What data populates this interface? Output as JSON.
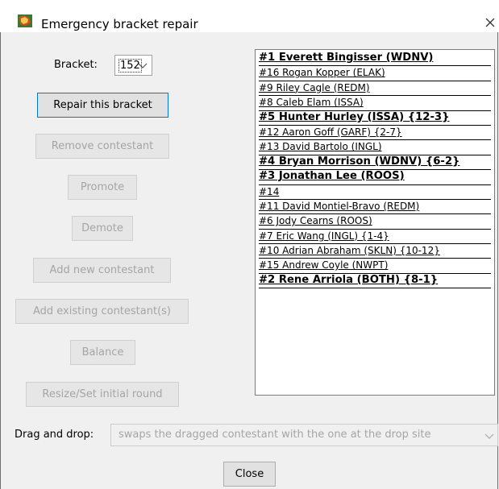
{
  "window": {
    "title": "Emergency bracket repair",
    "icon": "trophy-app-icon"
  },
  "bracket": {
    "label": "Bracket:",
    "value": "152"
  },
  "buttons": {
    "repair": "Repair this bracket",
    "remove": "Remove contestant",
    "promote": "Promote",
    "demote": "Demote",
    "add_new": "Add new contestant",
    "add_existing": "Add existing contestant(s)",
    "balance": "Balance",
    "resize": "Resize/Set initial round",
    "close": "Close"
  },
  "contestants": [
    {
      "text": "#1 Everett Bingisser (WDNV)",
      "bold": true
    },
    {
      "text": "#16 Rogan Kopper (ELAK)",
      "bold": false
    },
    {
      "text": "#9 Riley Cagle (REDM)",
      "bold": false
    },
    {
      "text": "#8 Caleb Elam (ISSA)",
      "bold": false
    },
    {
      "text": "#5 Hunter Hurley (ISSA) {12-3}",
      "bold": true
    },
    {
      "text": "#12 Aaron Goff (GARF) {2-7}",
      "bold": false
    },
    {
      "text": "#13 David Bartolo (INGL)",
      "bold": false
    },
    {
      "text": "#4 Bryan Morrison (WDNV) {6-2}",
      "bold": true
    },
    {
      "text": "#3 Jonathan Lee (ROOS)",
      "bold": true
    },
    {
      "text": "#14",
      "bold": false
    },
    {
      "text": "#11 David Montiel-Bravo (REDM)",
      "bold": false
    },
    {
      "text": "#6 Jody Cearns (ROOS)",
      "bold": false
    },
    {
      "text": "#7 Eric Wang (INGL) {1-4}",
      "bold": false
    },
    {
      "text": "#10 Adrian Abraham (SKLN) {10-12}",
      "bold": false
    },
    {
      "text": "#15 Andrew Coyle (NWPT)",
      "bold": false
    },
    {
      "text": "#2 Rene Arriola (BOTH) {8-1}",
      "bold": true
    }
  ],
  "drag_drop": {
    "label": "Drag and drop:",
    "value": "swaps the dragged contestant with the one at the drop site"
  }
}
